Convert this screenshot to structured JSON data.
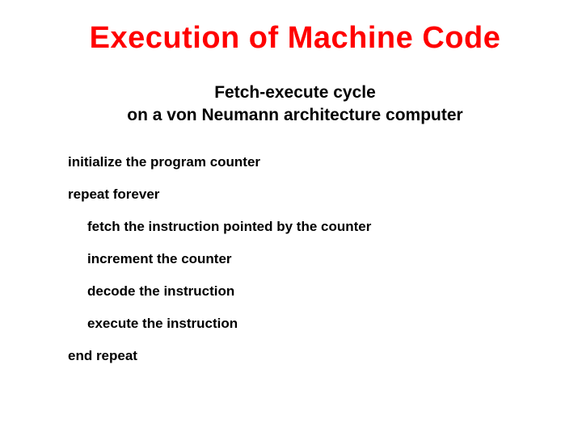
{
  "title": "Execution of Machine Code",
  "subtitle_line1": "Fetch-execute cycle",
  "subtitle_line2": "on a von Neumann architecture computer",
  "code": {
    "line1": "initialize the program counter",
    "line2": "repeat forever",
    "line3": "fetch the instruction pointed by the counter",
    "line4": "increment the counter",
    "line5": "decode the instruction",
    "line6": "execute the instruction",
    "line7": "end repeat"
  }
}
